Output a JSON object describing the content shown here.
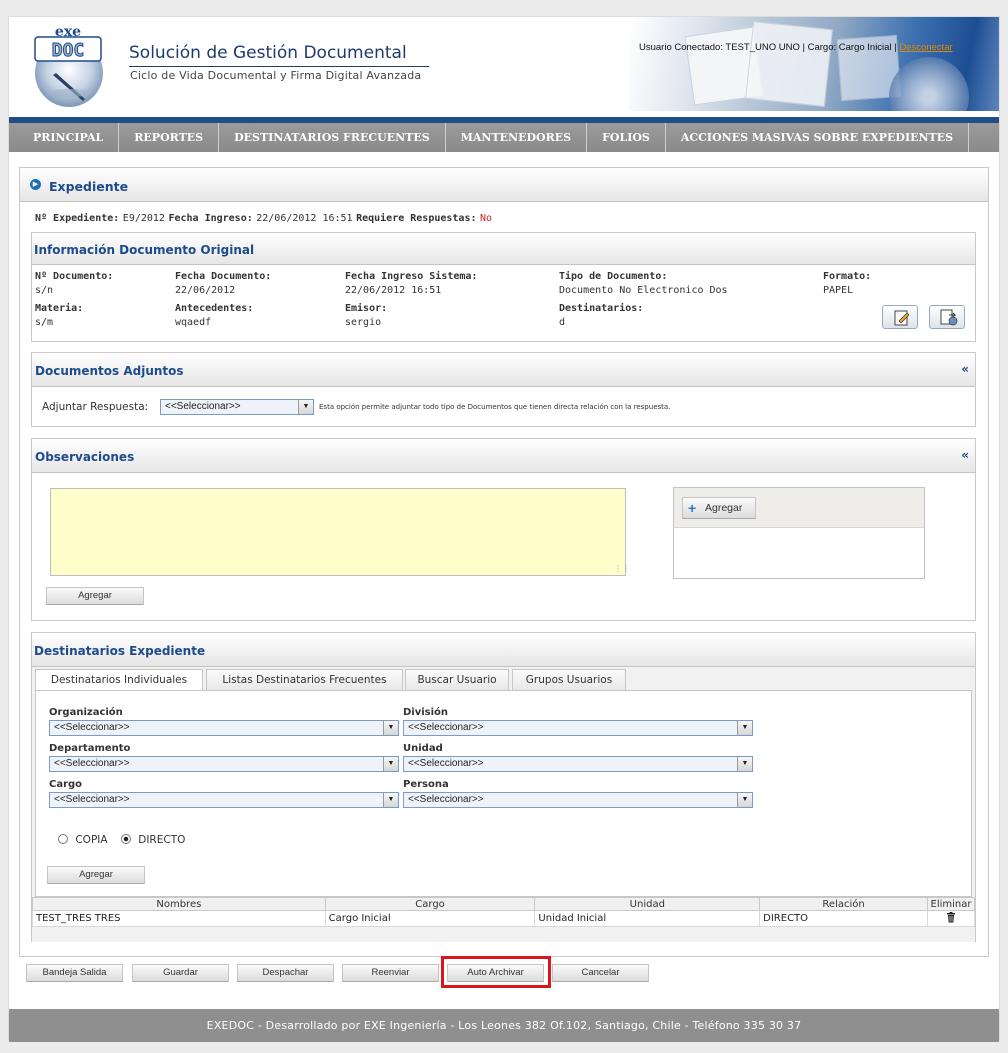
{
  "header": {
    "title": "Solución de Gestión Documental",
    "subtitle": "Ciclo de Vida Documental y Firma Digital Avanzada",
    "user_text": "Usuario Conectado: TEST_UNO UNO | Cargo: Cargo Inicial | ",
    "logout": "Desconectar",
    "logo_text_top": "exe",
    "logo_text_main": "DOC"
  },
  "nav": [
    "PRINCIPAL",
    "REPORTES",
    "DESTINATARIOS FRECUENTES",
    "MANTENEDORES",
    "FOLIOS",
    "ACCIONES MASIVAS SOBRE EXPEDIENTES"
  ],
  "expediente": {
    "title": "Expediente",
    "num_label": "Nº Expediente:",
    "num_value": "E9/2012",
    "fecha_label": "Fecha Ingreso:",
    "fecha_value": "22/06/2012 16:51",
    "resp_label": "Requiere Respuestas:",
    "resp_value": "No"
  },
  "doc_original": {
    "title": "Información Documento Original",
    "fields": [
      {
        "label": "Nº Documento:",
        "value": "s/n"
      },
      {
        "label": "Fecha Documento:",
        "value": "22/06/2012"
      },
      {
        "label": "Fecha Ingreso Sistema:",
        "value": "22/06/2012 16:51"
      },
      {
        "label": "Tipo de Documento:",
        "value": "Documento No Electronico Dos"
      },
      {
        "label": "Formato:",
        "value": "PAPEL"
      },
      {
        "label": "Materia:",
        "value": "s/m"
      },
      {
        "label": "Antecedentes:",
        "value": "wqaedf"
      },
      {
        "label": "Emisor:",
        "value": "sergio"
      },
      {
        "label": "Destinatarios:",
        "value": "d"
      }
    ]
  },
  "adjuntos": {
    "title": "Documentos Adjuntos",
    "collapse": "«",
    "label": "Adjuntar Respuesta:",
    "select_value": "<<Seleccionar>>",
    "hint": "Esta opción permite adjuntar todo tipo de Documentos que tienen directa relación con la respuesta."
  },
  "observaciones": {
    "title": "Observaciones",
    "collapse": "«",
    "textarea_value": "",
    "agregar_btn": "Agregar",
    "side_agregar": "Agregar"
  },
  "destinatarios": {
    "title": "Destinatarios Expediente",
    "tabs": [
      "Destinatarios Individuales",
      "Listas Destinatarios Frecuentes",
      "Buscar Usuario",
      "Grupos Usuarios"
    ],
    "fields": {
      "organizacion": {
        "label": "Organización",
        "value": "<<Seleccionar>>"
      },
      "division": {
        "label": "División",
        "value": "<<Seleccionar>>"
      },
      "departamento": {
        "label": "Departamento",
        "value": "<<Seleccionar>>"
      },
      "unidad": {
        "label": "Unidad",
        "value": "<<Seleccionar>>"
      },
      "cargo": {
        "label": "Cargo",
        "value": "<<Seleccionar>>"
      },
      "persona": {
        "label": "Persona",
        "value": "<<Seleccionar>>"
      }
    },
    "radio_copia": "COPIA",
    "radio_directo": "DIRECTO",
    "agregar_btn": "Agregar",
    "table": {
      "headers": [
        "Nombres",
        "Cargo",
        "Unidad",
        "Relación",
        "Eliminar"
      ],
      "rows": [
        {
          "nombres": "TEST_TRES TRES",
          "cargo": "Cargo Inicial",
          "unidad": "Unidad Inicial",
          "relacion": "DIRECTO"
        }
      ]
    }
  },
  "actions": [
    "Bandeja Salida",
    "Guardar",
    "Despachar",
    "Reenviar",
    "Auto Archivar",
    "Cancelar"
  ],
  "footer": "EXEDOC - Desarrollado por EXE Ingeniería - Los Leones 382 Of.102, Santiago, Chile - Teléfono 335 30 37"
}
